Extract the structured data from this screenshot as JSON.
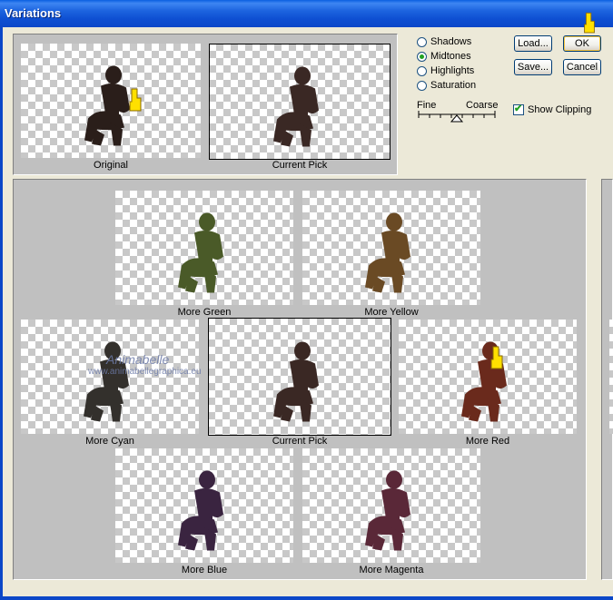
{
  "window": {
    "title": "Variations"
  },
  "top_previews": [
    {
      "label": "Original",
      "selected": false
    },
    {
      "label": "Current Pick",
      "selected": true
    }
  ],
  "tone_options": [
    {
      "label": "Shadows",
      "checked": false
    },
    {
      "label": "Midtones",
      "checked": true
    },
    {
      "label": "Highlights",
      "checked": false
    },
    {
      "label": "Saturation",
      "checked": false
    }
  ],
  "scale": {
    "fine_label": "Fine",
    "coarse_label": "Coarse",
    "level": 0.5
  },
  "buttons": {
    "load": "Load...",
    "ok": "OK",
    "save": "Save...",
    "cancel": "Cancel"
  },
  "show_clipping": {
    "label": "Show Clipping",
    "checked": true
  },
  "variations": [
    {
      "label": "More Green",
      "tint": "#4a5a28"
    },
    {
      "label": "More Yellow",
      "tint": "#6a4a24"
    },
    {
      "label": "More Cyan",
      "tint": "#33302c"
    },
    {
      "label": "Current Pick",
      "tint": "#3a2824"
    },
    {
      "label": "More Red",
      "tint": "#6a2a1c"
    },
    {
      "label": "More Blue",
      "tint": "#3a2440"
    },
    {
      "label": "More Magenta",
      "tint": "#5a2838"
    }
  ],
  "watermark": {
    "line1": "Animabelle",
    "line2": "www.animabellegraphica.eu"
  },
  "colors": {
    "title_bar": "#0B47C8",
    "dialog_bg": "#ECE9D8",
    "panel_bg": "#C0C0C0",
    "radio_dot": "#21A121"
  }
}
